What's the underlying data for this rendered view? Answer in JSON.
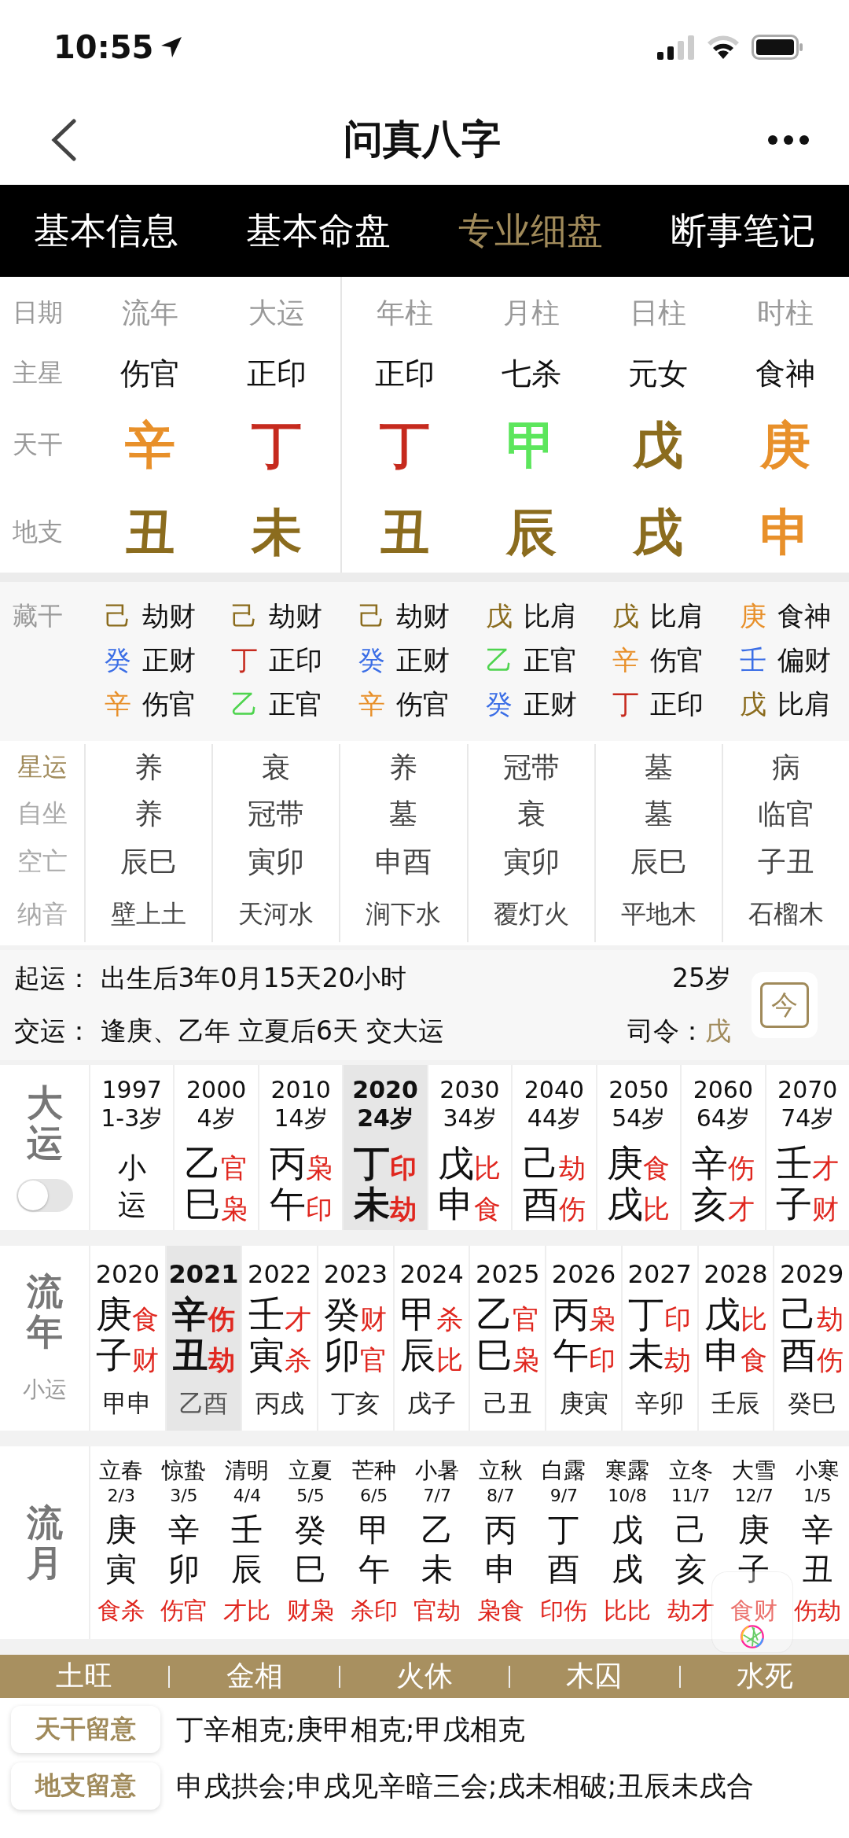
{
  "status_bar": {
    "time": "10:55"
  },
  "nav": {
    "title": "问真八字"
  },
  "tabs": [
    {
      "label": "基本信息",
      "selected": false
    },
    {
      "label": "基本命盘",
      "selected": false
    },
    {
      "label": "专业细盘",
      "selected": true
    },
    {
      "label": "断事笔记",
      "selected": false
    }
  ],
  "pillars": {
    "row_labels": [
      "日期",
      "主星",
      "天干",
      "地支"
    ],
    "columns": [
      {
        "header": "流年",
        "main_star": "伤官",
        "stem": {
          "char": "辛",
          "color": "#e8902a"
        },
        "branch": {
          "char": "丑",
          "color": "#8b6c1e"
        }
      },
      {
        "header": "大运",
        "main_star": "正印",
        "stem": {
          "char": "丁",
          "color": "#c62a1e"
        },
        "branch": {
          "char": "未",
          "color": "#8b6c1e"
        }
      },
      {
        "header": "年柱",
        "main_star": "正印",
        "stem": {
          "char": "丁",
          "color": "#c62a1e"
        },
        "branch": {
          "char": "丑",
          "color": "#8b6c1e"
        }
      },
      {
        "header": "月柱",
        "main_star": "七杀",
        "stem": {
          "char": "甲",
          "color": "#5ce65c"
        },
        "branch": {
          "char": "辰",
          "color": "#8b6c1e"
        }
      },
      {
        "header": "日柱",
        "main_star": "元女",
        "stem": {
          "char": "戊",
          "color": "#8b6c1e"
        },
        "branch": {
          "char": "戌",
          "color": "#8b6c1e"
        }
      },
      {
        "header": "时柱",
        "main_star": "食神",
        "stem": {
          "char": "庚",
          "color": "#e8902a"
        },
        "branch": {
          "char": "申",
          "color": "#e8902a"
        }
      }
    ]
  },
  "hidden_stems": {
    "label": "藏干",
    "columns": [
      [
        {
          "stem": "己",
          "color": "#8b6c1e",
          "god": "劫财"
        },
        {
          "stem": "癸",
          "color": "#3b6ee6",
          "god": "正财"
        },
        {
          "stem": "辛",
          "color": "#e8902a",
          "god": "伤官"
        }
      ],
      [
        {
          "stem": "己",
          "color": "#8b6c1e",
          "god": "劫财"
        },
        {
          "stem": "丁",
          "color": "#c62a1e",
          "god": "正印"
        },
        {
          "stem": "乙",
          "color": "#4ed44e",
          "god": "正官"
        }
      ],
      [
        {
          "stem": "己",
          "color": "#8b6c1e",
          "god": "劫财"
        },
        {
          "stem": "癸",
          "color": "#3b6ee6",
          "god": "正财"
        },
        {
          "stem": "辛",
          "color": "#e8902a",
          "god": "伤官"
        }
      ],
      [
        {
          "stem": "戊",
          "color": "#8b6c1e",
          "god": "比肩"
        },
        {
          "stem": "乙",
          "color": "#4ed44e",
          "god": "正官"
        },
        {
          "stem": "癸",
          "color": "#3b6ee6",
          "god": "正财"
        }
      ],
      [
        {
          "stem": "戊",
          "color": "#8b6c1e",
          "god": "比肩"
        },
        {
          "stem": "辛",
          "color": "#e8902a",
          "god": "伤官"
        },
        {
          "stem": "丁",
          "color": "#c62a1e",
          "god": "正印"
        }
      ],
      [
        {
          "stem": "庚",
          "color": "#e8902a",
          "god": "食神"
        },
        {
          "stem": "壬",
          "color": "#3b6ee6",
          "god": "偏财"
        },
        {
          "stem": "戊",
          "color": "#8b6c1e",
          "god": "比肩"
        }
      ]
    ]
  },
  "star_table": {
    "row_labels": [
      {
        "label": "星运",
        "selected": true
      },
      {
        "label": "自坐",
        "selected": false
      },
      {
        "label": "空亡",
        "selected": false
      },
      {
        "label": "纳音",
        "selected": false
      }
    ],
    "columns": [
      [
        "养",
        "养",
        "辰巳",
        "壁上土"
      ],
      [
        "衰",
        "冠带",
        "寅卯",
        "天河水"
      ],
      [
        "养",
        "墓",
        "申酉",
        "涧下水"
      ],
      [
        "冠带",
        "衰",
        "寅卯",
        "覆灯火"
      ],
      [
        "墓",
        "墓",
        "辰巳",
        "平地木"
      ],
      [
        "病",
        "临官",
        "子丑",
        "石榴木"
      ]
    ]
  },
  "luck_start": {
    "start_label": "起运：",
    "start_text": "出生后3年0月15天20小时",
    "age": "25岁",
    "exchange_label": "交运：",
    "exchange_text": "逢庚、乙年 立夏后6天 交大运",
    "commander_label": "司令：",
    "commander_value": "戊",
    "today_button": "今"
  },
  "dayun": {
    "label": "大运",
    "toggle_on": false,
    "items": [
      {
        "kind": "minor",
        "year": "1997",
        "age": "1-3岁",
        "text": "小运",
        "selected": false
      },
      {
        "kind": "pillar",
        "year": "2000",
        "age": "4岁",
        "stem": "乙",
        "stem_god": "官",
        "branch": "巳",
        "branch_god": "枭",
        "selected": false
      },
      {
        "kind": "pillar",
        "year": "2010",
        "age": "14岁",
        "stem": "丙",
        "stem_god": "枭",
        "branch": "午",
        "branch_god": "印",
        "selected": false
      },
      {
        "kind": "pillar",
        "year": "2020",
        "age": "24岁",
        "stem": "丁",
        "stem_god": "印",
        "branch": "未",
        "branch_god": "劫",
        "selected": true
      },
      {
        "kind": "pillar",
        "year": "2030",
        "age": "34岁",
        "stem": "戊",
        "stem_god": "比",
        "branch": "申",
        "branch_god": "食",
        "selected": false
      },
      {
        "kind": "pillar",
        "year": "2040",
        "age": "44岁",
        "stem": "己",
        "stem_god": "劫",
        "branch": "酉",
        "branch_god": "伤",
        "selected": false
      },
      {
        "kind": "pillar",
        "year": "2050",
        "age": "54岁",
        "stem": "庚",
        "stem_god": "食",
        "branch": "戌",
        "branch_god": "比",
        "selected": false
      },
      {
        "kind": "pillar",
        "year": "2060",
        "age": "64岁",
        "stem": "辛",
        "stem_god": "伤",
        "branch": "亥",
        "branch_god": "才",
        "selected": false
      },
      {
        "kind": "pillar",
        "year": "2070",
        "age": "74岁",
        "stem": "壬",
        "stem_god": "才",
        "branch": "子",
        "branch_god": "财",
        "selected": false
      }
    ]
  },
  "liunian": {
    "label": "流年",
    "sub_label": "小运",
    "items": [
      {
        "year": "2020",
        "stem": "庚",
        "stem_god": "食",
        "branch": "子",
        "branch_god": "财",
        "minor": "甲申",
        "selected": false
      },
      {
        "year": "2021",
        "stem": "辛",
        "stem_god": "伤",
        "branch": "丑",
        "branch_god": "劫",
        "minor": "乙酉",
        "selected": true
      },
      {
        "year": "2022",
        "stem": "壬",
        "stem_god": "才",
        "branch": "寅",
        "branch_god": "杀",
        "minor": "丙戌",
        "selected": false
      },
      {
        "year": "2023",
        "stem": "癸",
        "stem_god": "财",
        "branch": "卯",
        "branch_god": "官",
        "minor": "丁亥",
        "selected": false
      },
      {
        "year": "2024",
        "stem": "甲",
        "stem_god": "杀",
        "branch": "辰",
        "branch_god": "比",
        "minor": "戊子",
        "selected": false
      },
      {
        "year": "2025",
        "stem": "乙",
        "stem_god": "官",
        "branch": "巳",
        "branch_god": "枭",
        "minor": "己丑",
        "selected": false
      },
      {
        "year": "2026",
        "stem": "丙",
        "stem_god": "枭",
        "branch": "午",
        "branch_god": "印",
        "minor": "庚寅",
        "selected": false
      },
      {
        "year": "2027",
        "stem": "丁",
        "stem_god": "印",
        "branch": "未",
        "branch_god": "劫",
        "minor": "辛卯",
        "selected": false
      },
      {
        "year": "2028",
        "stem": "戊",
        "stem_god": "比",
        "branch": "申",
        "branch_god": "食",
        "minor": "壬辰",
        "selected": false
      },
      {
        "year": "2029",
        "stem": "己",
        "stem_god": "劫",
        "branch": "酉",
        "branch_god": "伤",
        "minor": "癸巳",
        "selected": false
      }
    ]
  },
  "liuyue": {
    "label": "流月",
    "items": [
      {
        "term": "立春",
        "date": "2/3",
        "stem": "庚",
        "branch": "寅",
        "gods": "食杀"
      },
      {
        "term": "惊蛰",
        "date": "3/5",
        "stem": "辛",
        "branch": "卯",
        "gods": "伤官"
      },
      {
        "term": "清明",
        "date": "4/4",
        "stem": "壬",
        "branch": "辰",
        "gods": "才比"
      },
      {
        "term": "立夏",
        "date": "5/5",
        "stem": "癸",
        "branch": "巳",
        "gods": "财枭"
      },
      {
        "term": "芒种",
        "date": "6/5",
        "stem": "甲",
        "branch": "午",
        "gods": "杀印"
      },
      {
        "term": "小暑",
        "date": "7/7",
        "stem": "乙",
        "branch": "未",
        "gods": "官劫"
      },
      {
        "term": "立秋",
        "date": "8/7",
        "stem": "丙",
        "branch": "申",
        "gods": "枭食"
      },
      {
        "term": "白露",
        "date": "9/7",
        "stem": "丁",
        "branch": "酉",
        "gods": "印伤"
      },
      {
        "term": "寒露",
        "date": "10/8",
        "stem": "戊",
        "branch": "戌",
        "gods": "比比"
      },
      {
        "term": "立冬",
        "date": "11/7",
        "stem": "己",
        "branch": "亥",
        "gods": "劫才"
      },
      {
        "term": "大雪",
        "date": "12/7",
        "stem": "庚",
        "branch": "子",
        "gods": "食财"
      },
      {
        "term": "小寒",
        "date": "1/5",
        "stem": "辛",
        "branch": "丑",
        "gods": "伤劫"
      }
    ]
  },
  "seasons": [
    "土旺",
    "金相",
    "火休",
    "木囚",
    "水死"
  ],
  "notes": [
    {
      "label": "天干留意",
      "text": "丁辛相克;庚甲相克;甲戊相克"
    },
    {
      "label": "地支留意",
      "text": "申戌拱会;申戌见辛暗三会;戌未相破;丑辰未戌合"
    }
  ]
}
